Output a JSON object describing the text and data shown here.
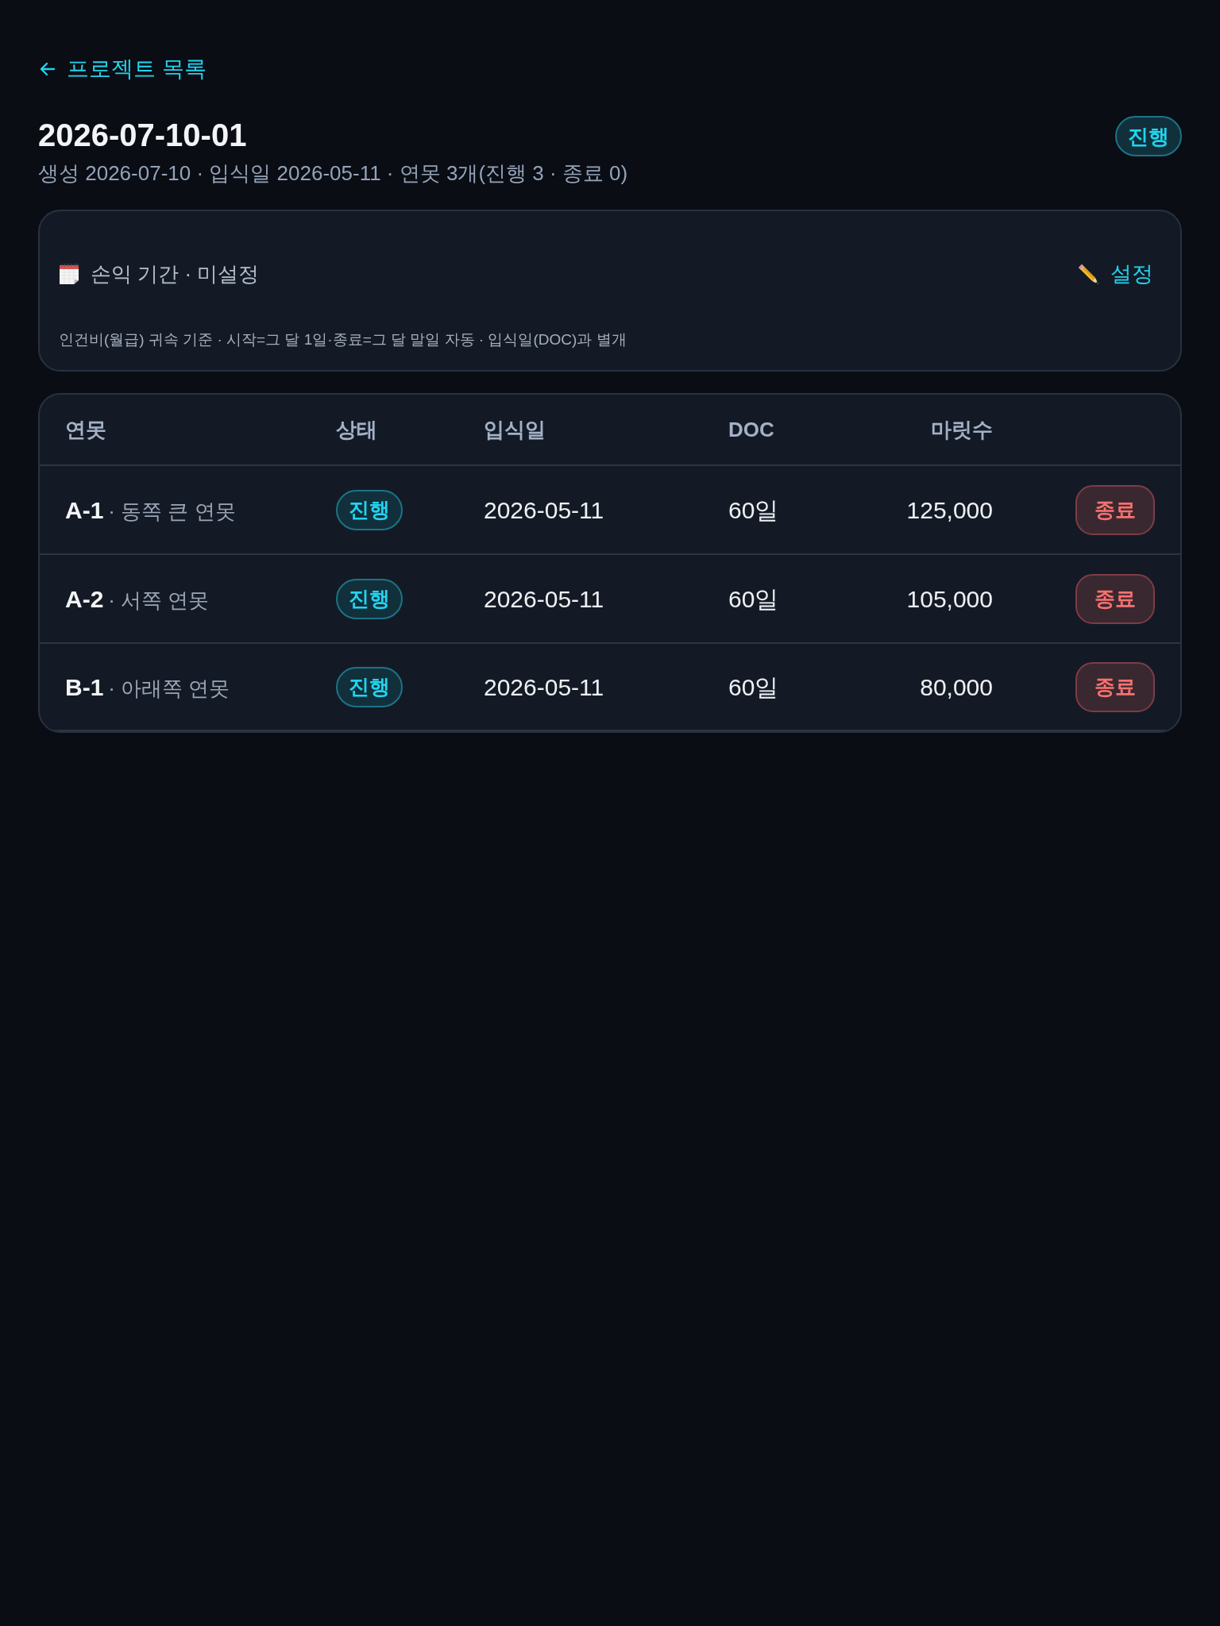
{
  "back_link": {
    "label": "프로젝트 목록"
  },
  "header": {
    "title": "2026-07-10-01",
    "meta": "생성 2026-07-10 · 입식일 2026-05-11 · 연못 3개(진행 3 · 종료 0)",
    "status": {
      "label": "진행",
      "kind": "active"
    }
  },
  "period_card": {
    "label": "손익 기간 · 미설정",
    "action": "설정",
    "note": "인건비(월급) 귀속 기준 · 시작=그 달 1일·종료=그 달 말일 자동 · 입식일(DOC)과 별개"
  },
  "table": {
    "columns": [
      "연못",
      "상태",
      "입식일",
      "DOC",
      "마릿수"
    ],
    "rows": [
      {
        "code": "A-1",
        "name": "· 동쪽 큰 연못",
        "status": {
          "label": "진행",
          "kind": "active"
        },
        "stocking_date": "2026-05-11",
        "doc": "60일",
        "count": "125,000",
        "action": "종료"
      },
      {
        "code": "A-2",
        "name": "· 서쪽 연못",
        "status": {
          "label": "진행",
          "kind": "active"
        },
        "stocking_date": "2026-05-11",
        "doc": "60일",
        "count": "105,000",
        "action": "종료"
      },
      {
        "code": "B-1",
        "name": "· 아래쪽 연못",
        "status": {
          "label": "진행",
          "kind": "active"
        },
        "stocking_date": "2026-05-11",
        "doc": "60일",
        "count": "80,000",
        "action": "종료"
      }
    ]
  }
}
